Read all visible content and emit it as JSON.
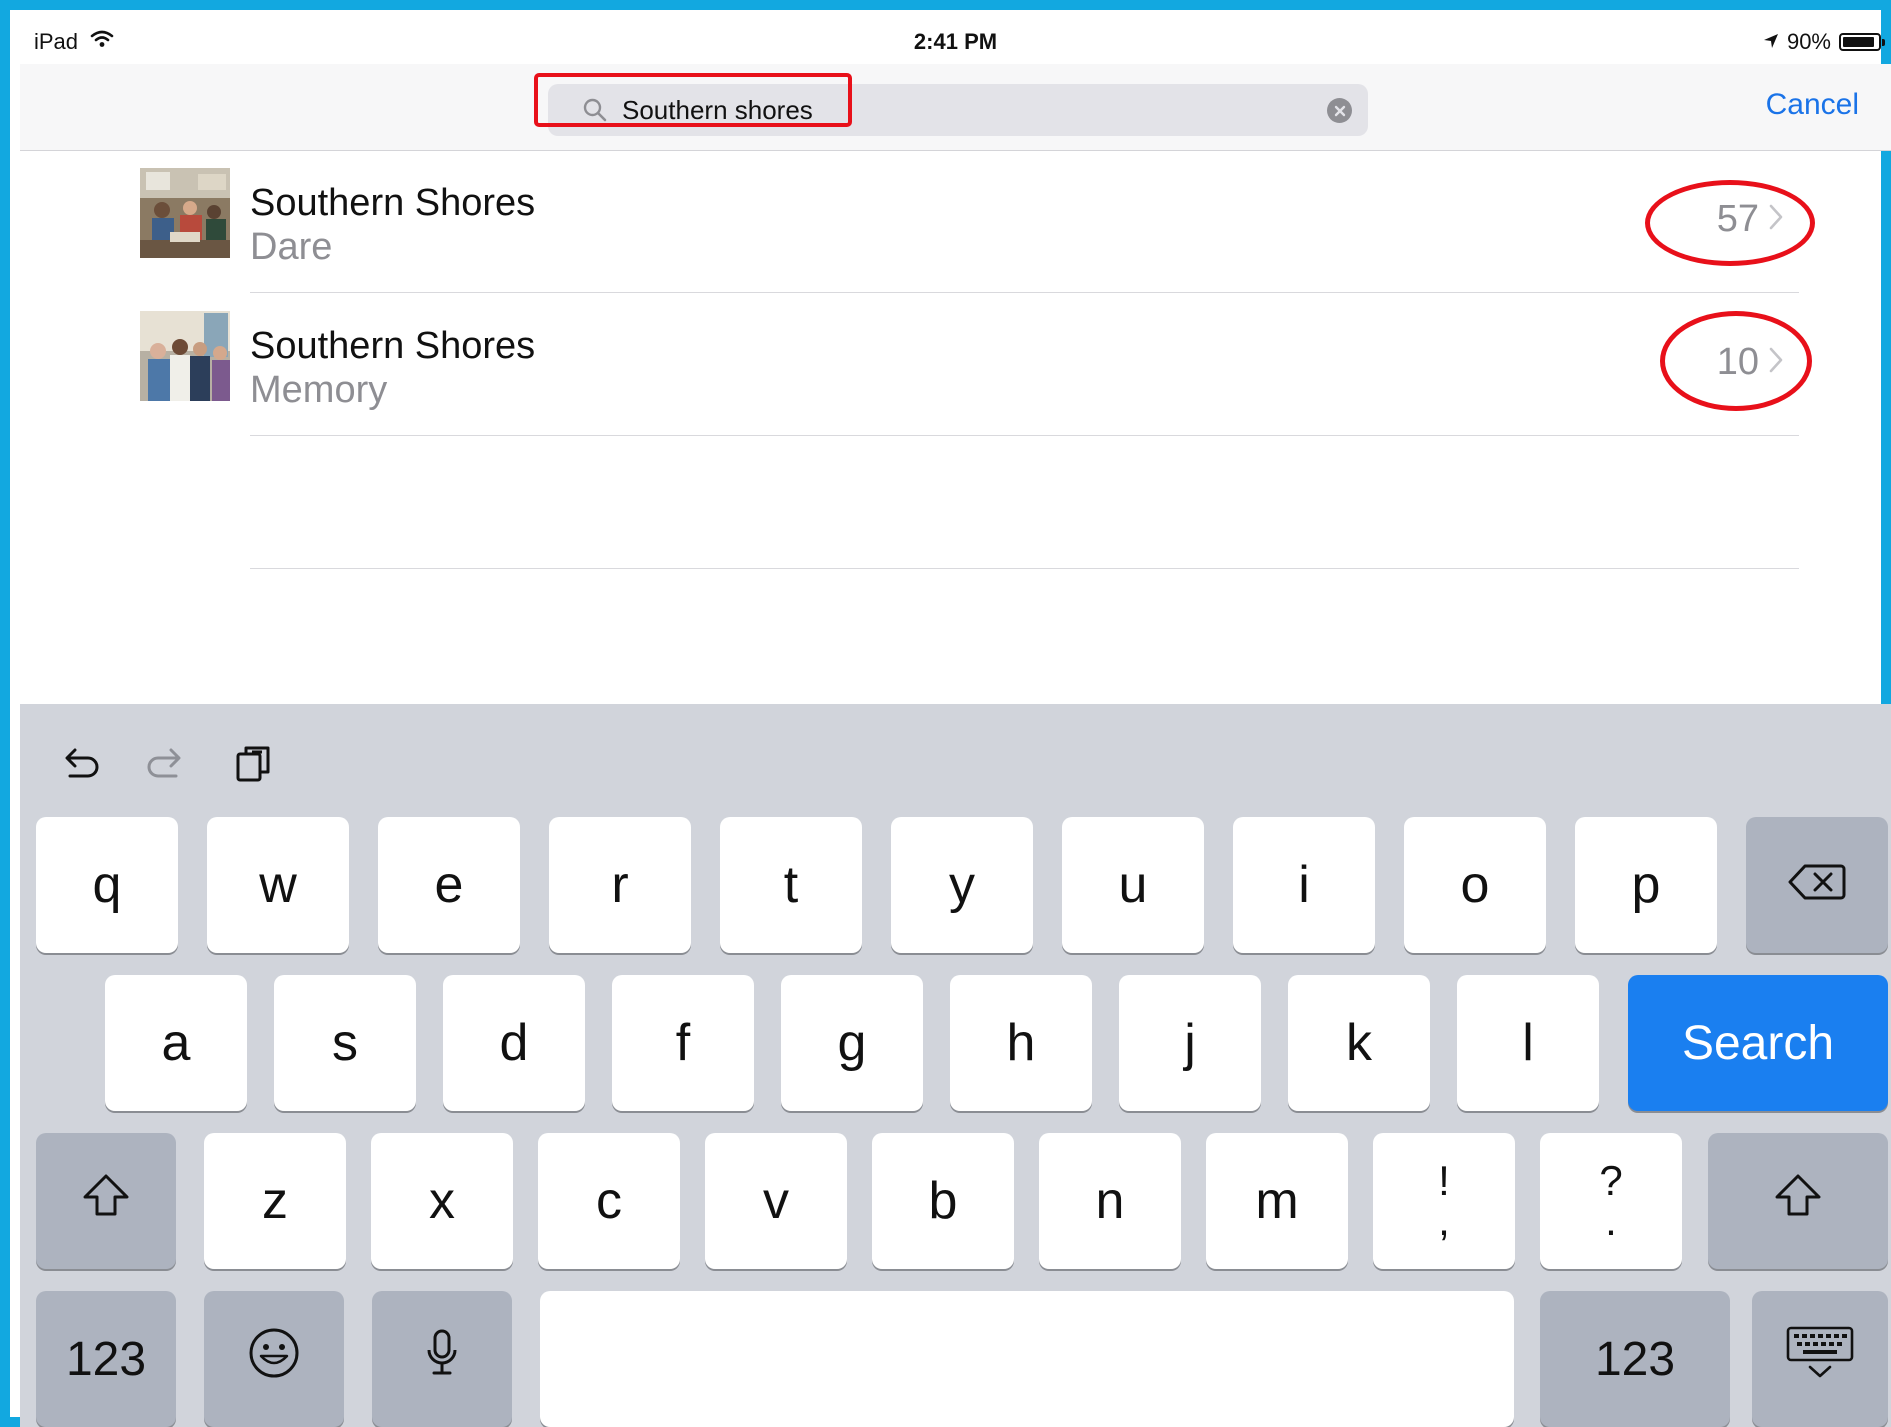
{
  "status_bar": {
    "device": "iPad",
    "time": "2:41 PM",
    "battery": "90%",
    "battery_level": 0.9
  },
  "search": {
    "value": "Southern shores",
    "cancel_label": "Cancel"
  },
  "results": [
    {
      "title": "Southern Shores",
      "subtitle": "Dare",
      "count": "57"
    },
    {
      "title": "Southern Shores",
      "subtitle": "Memory",
      "count": "10"
    }
  ],
  "keyboard": {
    "row1": [
      "q",
      "w",
      "e",
      "r",
      "t",
      "y",
      "u",
      "i",
      "o",
      "p"
    ],
    "row2": [
      "a",
      "s",
      "d",
      "f",
      "g",
      "h",
      "j",
      "k",
      "l"
    ],
    "row3": [
      "z",
      "x",
      "c",
      "v",
      "b",
      "n",
      "m"
    ],
    "punct": [
      {
        "top": "!",
        "bottom": ","
      },
      {
        "top": "?",
        "bottom": "."
      }
    ],
    "search_label": "Search",
    "numbers_label": "123"
  },
  "colors": {
    "accent": "#1a73e8",
    "search_key": "#1a7ff0",
    "annotation": "#e8101a",
    "frame": "#12a8e0"
  }
}
